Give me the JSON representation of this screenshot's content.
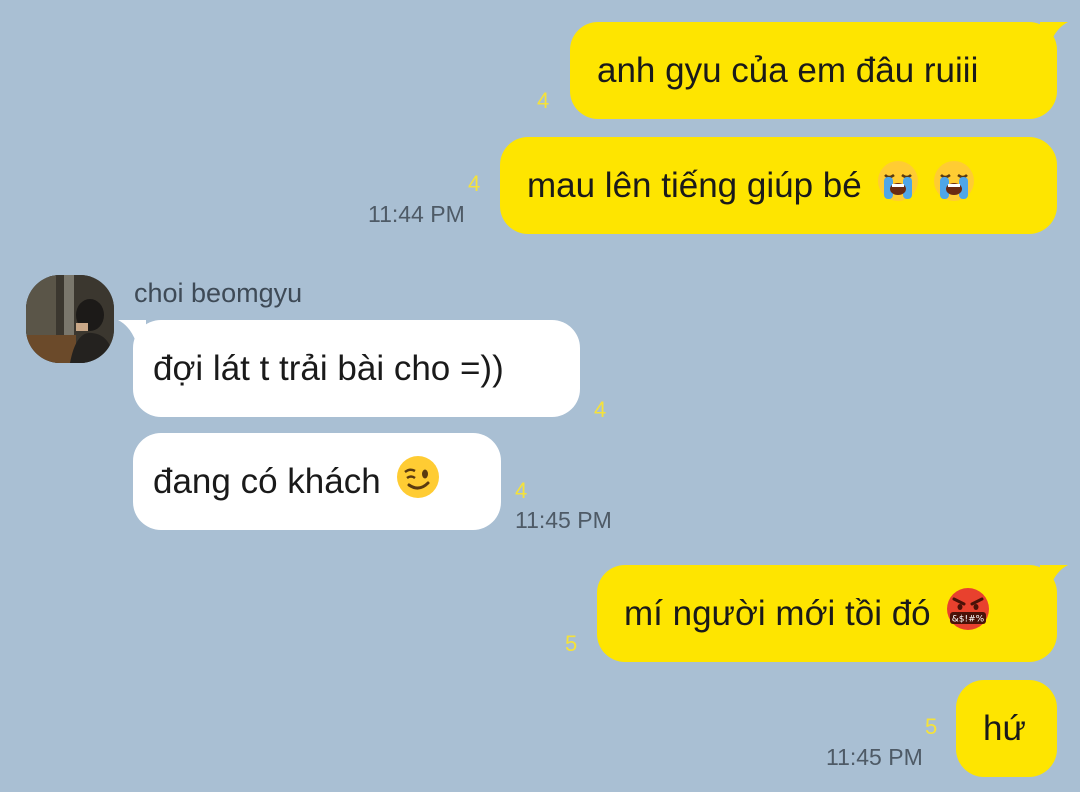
{
  "chat": {
    "contact_name": "choi beomgyu",
    "messages": [
      {
        "text": "anh gyu của em đâu ruiii",
        "unread": "4"
      },
      {
        "text": "mau lên tiếng giúp bé",
        "unread": "4",
        "time": "11:44 PM"
      },
      {
        "text": "đợi lát t trải bài cho =))",
        "unread": "4"
      },
      {
        "text": "đang có khách",
        "unread": "4",
        "time": "11:45 PM"
      },
      {
        "text": "mí người mới tồi đó",
        "unread": "5"
      },
      {
        "text": "hứ",
        "unread": "5",
        "time": "11:45 PM"
      }
    ],
    "emoji_labels": {
      "cursing_face_symbols": "&$!#%"
    }
  },
  "icons": [
    "loudly-crying-face-emoji",
    "winking-face-emoji",
    "face-with-symbols-on-mouth-emoji",
    "avatar-photo"
  ],
  "colors": {
    "background": "#a9bfd3",
    "my_bubble": "#fee500",
    "their_bubble": "#ffffff",
    "unread_count": "#f5e23a",
    "timestamp": "#4e5a66"
  }
}
